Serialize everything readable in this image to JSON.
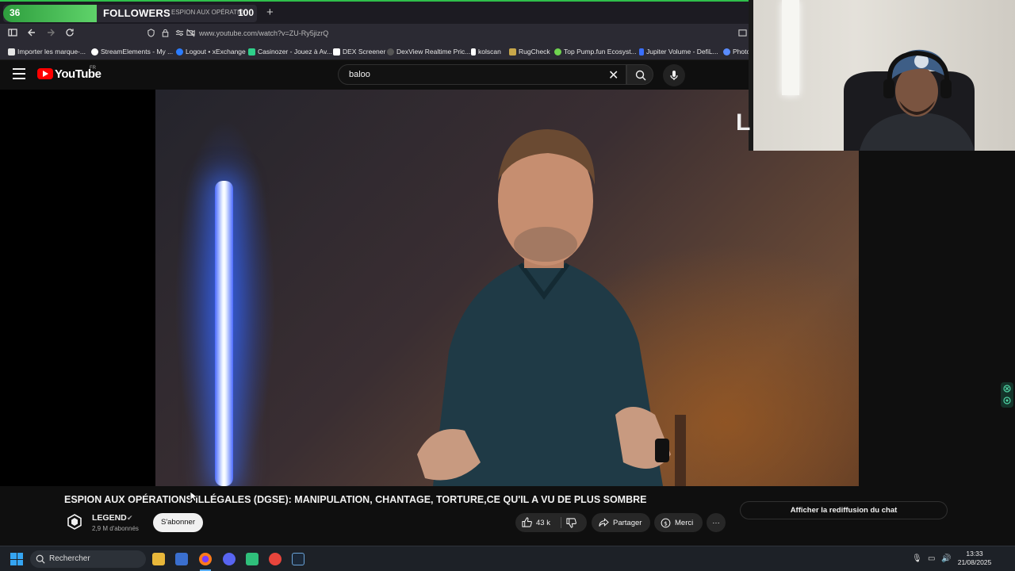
{
  "browser": {
    "tab": {
      "follower_count": "36",
      "goal_title": "FOLLOWERS",
      "tab_snippet": "ESPION AUX OPÉRATIO",
      "follower_goal": "100"
    },
    "new_tab_label": "+",
    "url": "www.youtube.com/watch?v=ZU-Ry5jizrQ",
    "bookmarks": [
      {
        "label": "Importer les marque-...",
        "icon": "import-icon",
        "color": "#e5e5e5"
      },
      {
        "label": "StreamElements - My ...",
        "icon": "streamelements-icon",
        "color": "#ffffff"
      },
      {
        "label": "Logout • xExchange",
        "icon": "xexchange-icon",
        "color": "#2b7cff"
      },
      {
        "label": "Casinozer - Jouez à Av...",
        "icon": "casinozer-icon",
        "color": "#2fd08a"
      },
      {
        "label": "DEX Screener",
        "icon": "dexscreener-icon",
        "color": "#ffffff"
      },
      {
        "label": "DexView Realtime Pric...",
        "icon": "dexview-icon",
        "color": "#3a3a3a"
      },
      {
        "label": "kolscan",
        "icon": "kolscan-icon",
        "color": "#ffffff"
      },
      {
        "label": "RugCheck",
        "icon": "rugcheck-icon",
        "color": "#c8a74a"
      },
      {
        "label": "Top Pump.fun Ecosyst...",
        "icon": "pumpfun-icon",
        "color": "#6fd34f"
      },
      {
        "label": "Jupiter Volume - DefiL...",
        "icon": "defillama-icon",
        "color": "#3a6fff"
      },
      {
        "label": "Photo",
        "icon": "photo-icon",
        "color": "#5a8cff"
      }
    ]
  },
  "youtube": {
    "logo_text": "YouTube",
    "country_code": "FR",
    "search_value": "baloo",
    "video": {
      "title": "ESPION AUX OPÉRATIONS ILLÉGALES (DGSE): MANIPULATION, CHANTAGE, TORTURE,CE QU'IL A VU DE PLUS SOMBRE",
      "overlay_letter": "L"
    },
    "channel": {
      "name": "LEGEND",
      "subscribers": "2,9 M d'abonnés",
      "subscribe_label": "S'abonner"
    },
    "actions": {
      "likes": "43 k",
      "share_label": "Partager",
      "thanks_label": "Merci",
      "more_label": "···"
    },
    "chat_replay_label": "Afficher la rediffusion du chat"
  },
  "taskbar": {
    "search_placeholder": "Rechercher",
    "time": "13:33",
    "date": "21/08/2025",
    "apps": [
      "file-explorer-icon",
      "store-icon",
      "firefox-icon",
      "discord-icon",
      "app-green-icon",
      "app-red-icon",
      "steam-icon"
    ]
  },
  "colors": {
    "follower_bar": "#2e9e3e",
    "youtube_red": "#ff0000",
    "background": "#0f0f0f"
  }
}
